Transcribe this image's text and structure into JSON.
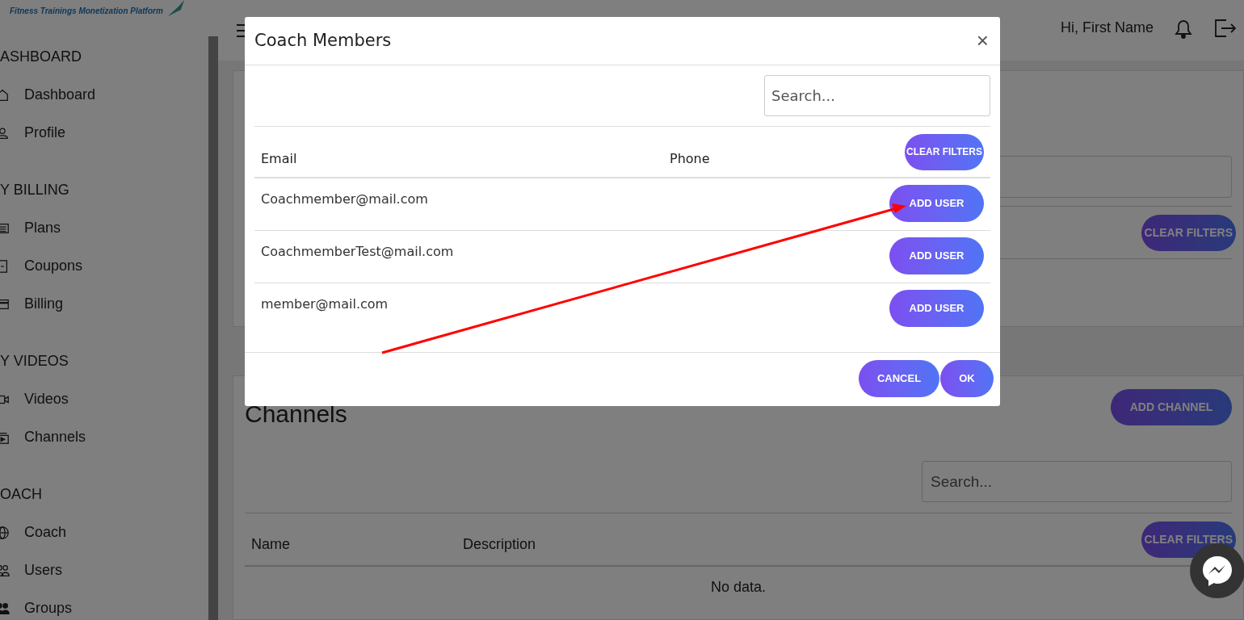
{
  "logo": {
    "tagline": "Fitness Trainings Monetization Platform"
  },
  "sidebar": {
    "sections": [
      {
        "title": "ASHBOARD",
        "items": [
          {
            "label": "Dashboard",
            "kind": "home"
          },
          {
            "label": "Profile",
            "kind": "user"
          }
        ]
      },
      {
        "title": "Y BILLING",
        "items": [
          {
            "label": "Plans",
            "kind": "list"
          },
          {
            "label": "Coupons",
            "kind": "coupon"
          },
          {
            "label": "Billing",
            "kind": "card"
          }
        ]
      },
      {
        "title": "Y VIDEOS",
        "items": [
          {
            "label": "Videos",
            "kind": "video"
          },
          {
            "label": "Channels",
            "kind": "channel"
          }
        ]
      },
      {
        "title": "OACH",
        "items": [
          {
            "label": "Coach",
            "kind": "globe"
          },
          {
            "label": "Users",
            "kind": "users"
          },
          {
            "label": "Groups",
            "kind": "groups"
          }
        ]
      }
    ]
  },
  "header": {
    "greeting": "Hi, First Name"
  },
  "top_card": {
    "clear_filters": "CLEAR FILTERS"
  },
  "channels_card": {
    "title": "Channels",
    "add_button": "ADD CHANNEL",
    "search_placeholder": "Search...",
    "columns": [
      "Name",
      "Description"
    ],
    "clear_filters": "CLEAR FILTERS",
    "empty": "No data."
  },
  "modal": {
    "title": "Coach Members",
    "close": "×",
    "search_placeholder": "Search...",
    "columns": [
      "Email",
      "Phone"
    ],
    "clear_filters": "CLEAR FILTERS",
    "rows": [
      {
        "email": "Coachmember@mail.com",
        "action": "ADD USER"
      },
      {
        "email": "CoachmemberTest@mail.com",
        "action": "ADD USER"
      },
      {
        "email": "member@mail.com",
        "action": "ADD USER"
      }
    ],
    "buttons": [
      "CANCEL",
      "OK"
    ]
  }
}
